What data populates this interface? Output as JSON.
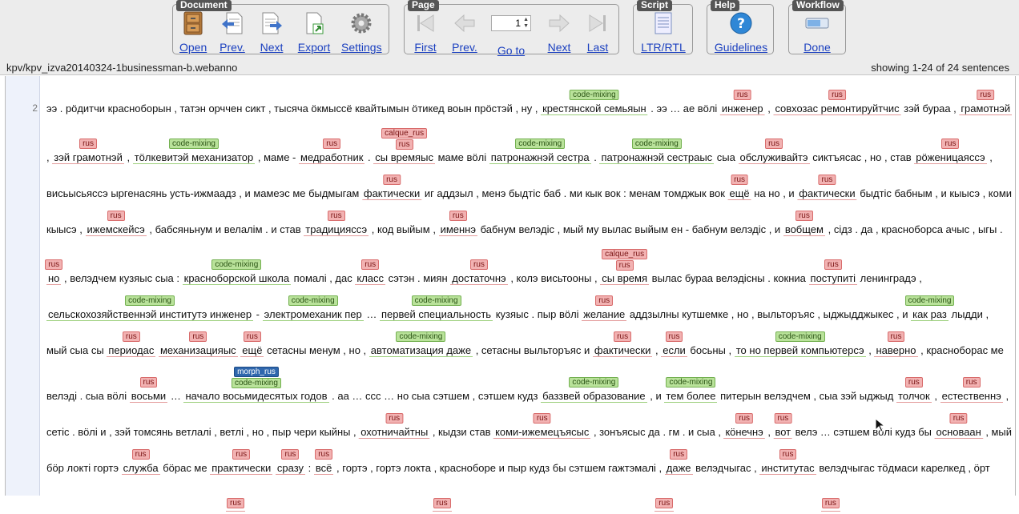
{
  "toolbar": {
    "document": {
      "title": "Document",
      "buttons": [
        {
          "label": "Open",
          "icon": "cabinet-icon"
        },
        {
          "label": "Prev.",
          "icon": "prev-document-icon"
        },
        {
          "label": "Next",
          "icon": "next-document-icon"
        },
        {
          "label": "Export",
          "icon": "export-icon"
        },
        {
          "label": "Settings",
          "icon": "gear-icon"
        }
      ]
    },
    "page": {
      "title": "Page",
      "buttons": [
        {
          "label": "First",
          "icon": "first-page-icon"
        },
        {
          "label": "Prev.",
          "icon": "prev-page-icon"
        },
        {
          "label": "Go to",
          "icon": "goto-icon"
        },
        {
          "label": "Next",
          "icon": "next-page-icon"
        },
        {
          "label": "Last",
          "icon": "last-page-icon"
        }
      ],
      "page_value": "1"
    },
    "script": {
      "title": "Script",
      "buttons": [
        {
          "label": "LTR/RTL",
          "icon": "script-direction-icon"
        }
      ]
    },
    "help": {
      "title": "Help",
      "buttons": [
        {
          "label": "Guidelines",
          "icon": "question-icon"
        }
      ]
    },
    "workflow": {
      "title": "Workflow",
      "buttons": [
        {
          "label": "Done",
          "icon": "progress-bar-icon"
        }
      ]
    }
  },
  "infobar": {
    "document_name": "kpv/kpv_izva20140324-1businessman-b.webanno",
    "sentence_count": "showing 1-24 of 24 sentences"
  },
  "editor": {
    "sentence_number": "2",
    "colors": {
      "rus": "#f2b2b2",
      "code_mixing": "#b9e29a",
      "morph_rus": "#2f67ad"
    },
    "rows": [
      [
        {
          "t": "ээ . рӧдитчи красноборын , татэн орччен сикт , тысяча ӧкмыссё квайтымын ӧтикед воын прӧстэй , ну ,"
        },
        {
          "t": "крестянской семьяын",
          "l": [
            "code-mixing"
          ]
        },
        {
          "t": ". ээ … ае вӧлі"
        },
        {
          "t": "инженер",
          "l": [
            "rus"
          ]
        },
        {
          "t": ","
        },
        {
          "t": "совхозас ремонтируйтчис",
          "l": [
            "rus"
          ]
        },
        {
          "t": "зэй бураа ,"
        },
        {
          "t": "грамотнэй",
          "l": [
            "rus"
          ]
        }
      ],
      [
        {
          "t": ","
        },
        {
          "t": "зэй грамотнэй",
          "l": [
            "rus"
          ]
        },
        {
          "t": ","
        },
        {
          "t": "тӧлкевитэй механизатор",
          "l": [
            "code-mixing"
          ]
        },
        {
          "t": ", маме -"
        },
        {
          "t": "медработник",
          "l": [
            "rus"
          ]
        },
        {
          "t": "."
        },
        {
          "t": "сы времяыс",
          "l": [
            "calque_rus",
            "rus"
          ]
        },
        {
          "t": "маме вӧлі"
        },
        {
          "t": "патронажнэй сестра",
          "l": [
            "code-mixing"
          ]
        },
        {
          "t": "."
        },
        {
          "t": "патронажнэй сестраыс",
          "l": [
            "code-mixing"
          ]
        },
        {
          "t": "сыа"
        },
        {
          "t": "обслуживайтэ",
          "l": [
            "rus"
          ]
        },
        {
          "t": "сиктъясас , но , став"
        },
        {
          "t": "рӧженицаяссэ",
          "l": [
            "rus"
          ]
        },
        {
          "t": ","
        }
      ],
      [
        {
          "t": "висьысьяссэ ыргенасянь усть-ижмаадз , и мамеэс ме быдмыгам"
        },
        {
          "t": "фактически",
          "l": [
            "rus"
          ]
        },
        {
          "t": "иг аддзыл , менэ быдтіс баб . ми кык вок : менам томджык вок"
        },
        {
          "t": "ещё",
          "l": [
            "rus"
          ]
        },
        {
          "t": "на но , и"
        },
        {
          "t": "фактически",
          "l": [
            "rus"
          ]
        },
        {
          "t": "быдтіс бабным , и кыысэ , коми"
        }
      ],
      [
        {
          "t": "кыысэ ,"
        },
        {
          "t": "ижемскейсэ",
          "l": [
            "rus"
          ]
        },
        {
          "t": ", бабсяньнум и велалім . и став"
        },
        {
          "t": "традицияссэ",
          "l": [
            "rus"
          ]
        },
        {
          "t": ", код выйым ,"
        },
        {
          "t": "именнэ",
          "l": [
            "rus"
          ]
        },
        {
          "t": "бабнум велэдіс , мый му вылас выйым ен - бабнум велэдіс , и"
        },
        {
          "t": "вобщем",
          "l": [
            "rus"
          ]
        },
        {
          "t": ", сідз . да , красноборса ачыс , ыгы ."
        }
      ],
      [
        {
          "t": "но",
          "l": [
            "rus"
          ]
        },
        {
          "t": ", велэдчем кузяыс сыа :"
        },
        {
          "t": "красноборской школа",
          "l": [
            "code-mixing"
          ]
        },
        {
          "t": "помалі , дас"
        },
        {
          "t": "класс",
          "l": [
            "rus"
          ]
        },
        {
          "t": "сэтэн . миян"
        },
        {
          "t": "достаточнэ",
          "l": [
            "rus"
          ]
        },
        {
          "t": ", колэ висьтооны ,"
        },
        {
          "t": "сы время",
          "l": [
            "calque_rus",
            "rus"
          ]
        },
        {
          "t": "вылас бураа велэдісны . кокниа"
        },
        {
          "t": "поступиті",
          "l": [
            "rus"
          ]
        },
        {
          "t": "ленинградэ ,"
        }
      ],
      [
        {
          "t": "сельскохозяйственнэй институтэ инженер",
          "l": [
            "code-mixing"
          ]
        },
        {
          "t": "-"
        },
        {
          "t": "электромеханик пер",
          "l": [
            "code-mixing"
          ]
        },
        {
          "t": "…"
        },
        {
          "t": "первей специальность",
          "l": [
            "code-mixing"
          ]
        },
        {
          "t": "кузяыс . пыр вӧлі"
        },
        {
          "t": "желание",
          "l": [
            "rus"
          ]
        },
        {
          "t": "аддзылны кутшемке , но , выльторъяс , ыджыдджыкес , и"
        },
        {
          "t": "как раз",
          "l": [
            "code-mixing"
          ]
        },
        {
          "t": "лыдди ,"
        }
      ],
      [
        {
          "t": "мый сыа сы"
        },
        {
          "t": "периодас",
          "l": [
            "rus"
          ]
        },
        {
          "t": "механизацияыс",
          "l": [
            "rus"
          ]
        },
        {
          "t": "ещё",
          "l": [
            "rus"
          ]
        },
        {
          "t": "сетасны менум , но ,"
        },
        {
          "t": "автоматизация даже",
          "l": [
            "code-mixing"
          ]
        },
        {
          "t": ", сетасны выльторъяс и"
        },
        {
          "t": "фактически",
          "l": [
            "rus"
          ]
        },
        {
          "t": ","
        },
        {
          "t": "если",
          "l": [
            "rus"
          ]
        },
        {
          "t": "босьны ,"
        },
        {
          "t": "то но первей компьютерсэ",
          "l": [
            "code-mixing"
          ]
        },
        {
          "t": ","
        },
        {
          "t": "наверно",
          "l": [
            "rus"
          ]
        },
        {
          "t": ", красноборас ме"
        }
      ],
      [
        {
          "t": "велэдi . сыа вӧлі"
        },
        {
          "t": "восьми",
          "l": [
            "rus"
          ]
        },
        {
          "t": "…"
        },
        {
          "t": "начало восьмидесятых годов",
          "l": [
            "morph_rus",
            "code-mixing"
          ]
        },
        {
          "t": ". аа … ссс … но сыа сэтшем , сэтшем кудз"
        },
        {
          "t": "баззвей образование",
          "l": [
            "code-mixing"
          ]
        },
        {
          "t": ", и"
        },
        {
          "t": "тем более",
          "l": [
            "code-mixing"
          ]
        },
        {
          "t": "питерын велэдчем , сыа зэй ыджыд"
        },
        {
          "t": "толчок",
          "l": [
            "rus"
          ]
        },
        {
          "t": ","
        },
        {
          "t": "естественнэ",
          "l": [
            "rus"
          ]
        },
        {
          "t": ","
        }
      ],
      [
        {
          "t": "сетіс . вӧлі и , зэй томсянь ветлалі , ветлі , но , пыр чери кыйны ,"
        },
        {
          "t": "охотничайтны",
          "l": [
            "rus"
          ]
        },
        {
          "t": ", кыдзи став"
        },
        {
          "t": "коми-ижемецъясыс",
          "l": [
            "rus"
          ]
        },
        {
          "t": ", зонъясыс да . гм . и сыа ,"
        },
        {
          "t": "кӧнечнэ",
          "l": [
            "rus"
          ]
        },
        {
          "t": ","
        },
        {
          "t": "вот",
          "l": [
            "rus"
          ]
        },
        {
          "t": "велэ … сэтшем вӧлі кудз бы"
        },
        {
          "t": "основаан",
          "l": [
            "rus"
          ]
        },
        {
          "t": ", мый"
        }
      ],
      [
        {
          "t": "бӧр локті гортэ"
        },
        {
          "t": "служба",
          "l": [
            "rus"
          ]
        },
        {
          "t": "бӧрас ме"
        },
        {
          "t": "практически",
          "l": [
            "rus"
          ]
        },
        {
          "t": "сразу",
          "l": [
            "rus"
          ]
        },
        {
          "t": ":"
        },
        {
          "t": "всё",
          "l": [
            "rus"
          ]
        },
        {
          "t": ", гортэ , гортэ локта , красноборе и пыр кудз бы сэтшем гажтэмалі ,"
        },
        {
          "t": "даже",
          "l": [
            "rus"
          ]
        },
        {
          "t": "велэдчыгас ,"
        },
        {
          "t": "институтас",
          "l": [
            "rus"
          ]
        },
        {
          "t": "велэдчыгас тӧдмаси карелкед , ӧрт"
        }
      ],
      [
        {
          "t": "",
          "l": [
            "rus"
          ]
        },
        {
          "t": "",
          "l": [
            "rus"
          ]
        },
        {
          "t": "",
          "l": [
            "rus"
          ]
        },
        {
          "t": "",
          "l": [
            "rus"
          ]
        }
      ]
    ]
  }
}
